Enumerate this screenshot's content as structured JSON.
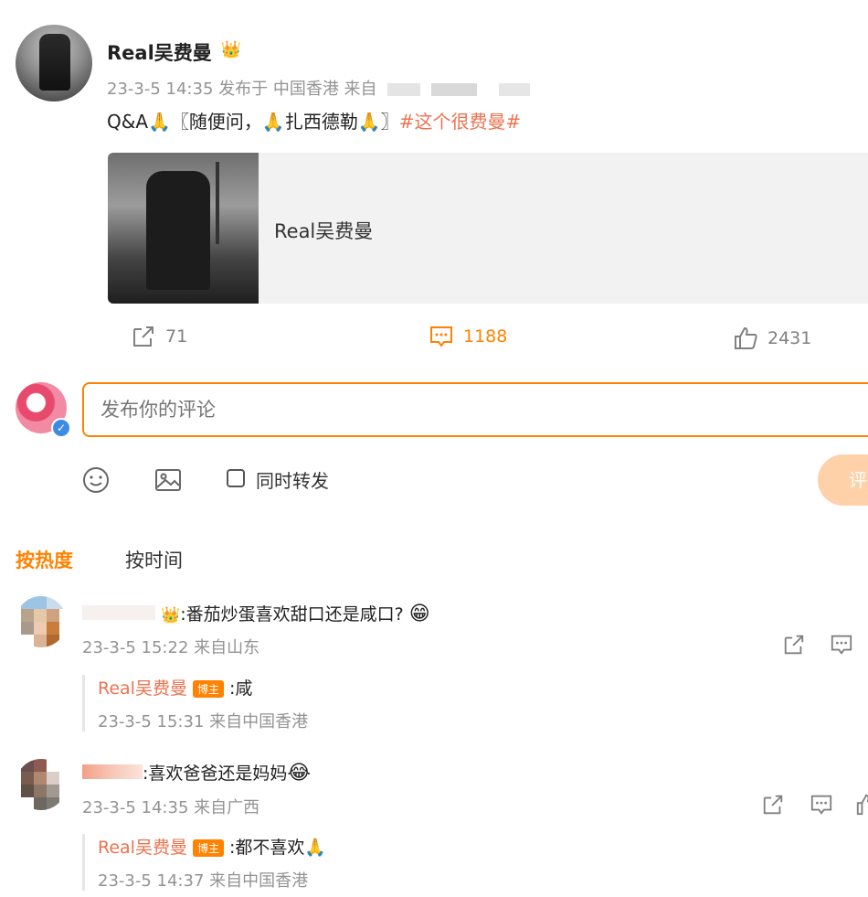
{
  "post": {
    "username": "Real吴费曼",
    "crown_icon": "crown-badge-icon",
    "meta": "23-3-5 14:35 发布于 中国香港 来自",
    "content_prefix": "Q&A🙏〖随便问，🙏扎西德勒🙏〗",
    "hashtag": "#这个很费曼#",
    "card_title": "Real吴费曼"
  },
  "actions": {
    "share_count": "71",
    "comment_count": "1188",
    "like_count": "2431"
  },
  "composer": {
    "placeholder": "发布你的评论",
    "repost_label": "同时转发",
    "submit_label": "评"
  },
  "sort": {
    "hot": "按热度",
    "time": "按时间"
  },
  "comments": [
    {
      "text": ":番茄炒蛋喜欢甜口还是咸口?",
      "emoji": "😁",
      "meta": "23-3-5 15:22 来自山东",
      "reply": {
        "name": "Real吴费曼",
        "badge": "博主",
        "text": ":咸",
        "meta": "23-3-5 15:31 来自中国香港"
      }
    },
    {
      "text": ":喜欢爸爸还是妈妈",
      "emoji": "😂",
      "meta": "23-3-5 14:35 来自广西",
      "reply": {
        "name": "Real吴费曼",
        "badge": "博主",
        "text": ":都不喜欢🙏",
        "meta": "23-3-5 14:37 来自中国香港"
      }
    }
  ],
  "colors": {
    "accent": "#ff8200",
    "link": "#eb7350",
    "muted": "#939393"
  }
}
